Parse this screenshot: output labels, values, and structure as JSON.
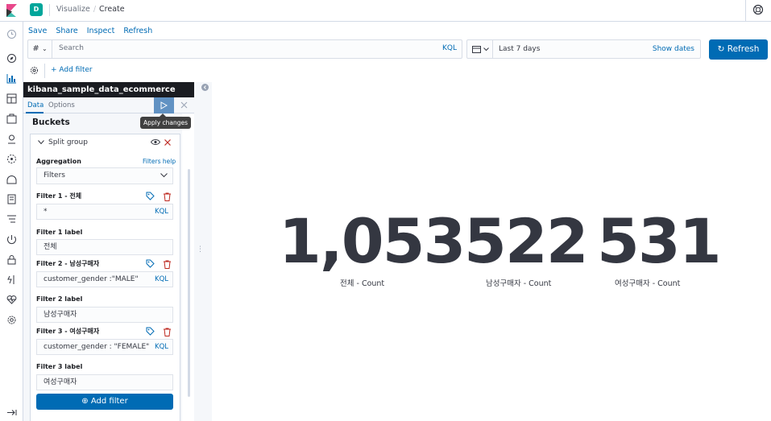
{
  "header": {
    "space_initial": "D",
    "breadcrumbs": [
      "Visualize",
      "Create"
    ]
  },
  "top_menu": [
    "Save",
    "Share",
    "Inspect",
    "Refresh"
  ],
  "query_bar": {
    "language_symbol": "#",
    "placeholder": "Search",
    "language": "KQL"
  },
  "time_picker": {
    "range": "Last 7 days",
    "show_dates": "Show dates"
  },
  "refresh_button": "Refresh",
  "add_filter_top": "+ Add filter",
  "editor": {
    "index_pattern": "kibana_sample_data_ecommerce",
    "tabs": [
      "Data",
      "Options"
    ],
    "apply_tooltip": "Apply changes",
    "buckets_title": "Buckets",
    "group_title": "Split group",
    "aggregation_label": "Aggregation",
    "aggregation_help": "Filters help",
    "aggregation_value": "Filters",
    "filters": [
      {
        "title": "Filter 1 - 전체",
        "query": "*",
        "lang": "KQL",
        "label_title": "Filter 1 label",
        "label_value": "전체"
      },
      {
        "title": "Filter 2 - 남성구매자",
        "query": "customer_gender :\"MALE\"",
        "lang": "KQL",
        "label_title": "Filter 2 label",
        "label_value": "남성구매자"
      },
      {
        "title": "Filter 3 - 여성구매자",
        "query": "customer_gender : \"FEMALE\"",
        "lang": "KQL",
        "label_title": "Filter 3 label",
        "label_value": "여성구매자"
      }
    ],
    "add_filter_button": "Add filter"
  },
  "metrics": [
    {
      "value": "1,053",
      "label": "전체 - Count"
    },
    {
      "value": "522",
      "label": "남성구매자 - Count"
    },
    {
      "value": "531",
      "label": "여성구매자 - Count"
    }
  ],
  "colors": {
    "primary": "#006bb4",
    "space_avatar": "#00a69b",
    "header_dark": "#1a1c21",
    "danger": "#bd271e"
  }
}
